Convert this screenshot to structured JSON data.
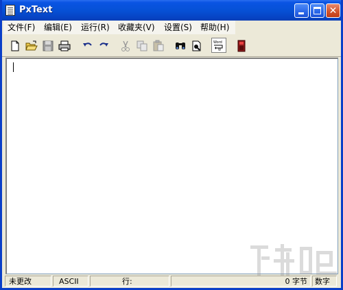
{
  "window": {
    "title": "PxText"
  },
  "menu": [
    {
      "label": "文件(F)"
    },
    {
      "label": "编辑(E)"
    },
    {
      "label": "运行(R)"
    },
    {
      "label": "收藏夹(V)"
    },
    {
      "label": "设置(S)"
    },
    {
      "label": "帮助(H)"
    }
  ],
  "toolbar": {
    "items": [
      "new-file-icon",
      "open-folder-icon",
      "save-icon",
      "print-icon",
      "undo-icon",
      "redo-icon",
      "cut-icon",
      "copy-icon",
      "paste-icon",
      "find-icon",
      "find-next-icon",
      "word-wrap-icon",
      "run-icon"
    ],
    "word_wrap_label": "Word\nWrap"
  },
  "editor": {
    "content": ""
  },
  "status": {
    "modified": "未更改",
    "encoding": "ASCII",
    "line_label": "行:",
    "line_value": "",
    "bytes": "0 字节",
    "numlock": "数字"
  },
  "colors": {
    "titlebar": "#0651d6",
    "chrome": "#ece9d8",
    "close_button": "#d4562e"
  }
}
